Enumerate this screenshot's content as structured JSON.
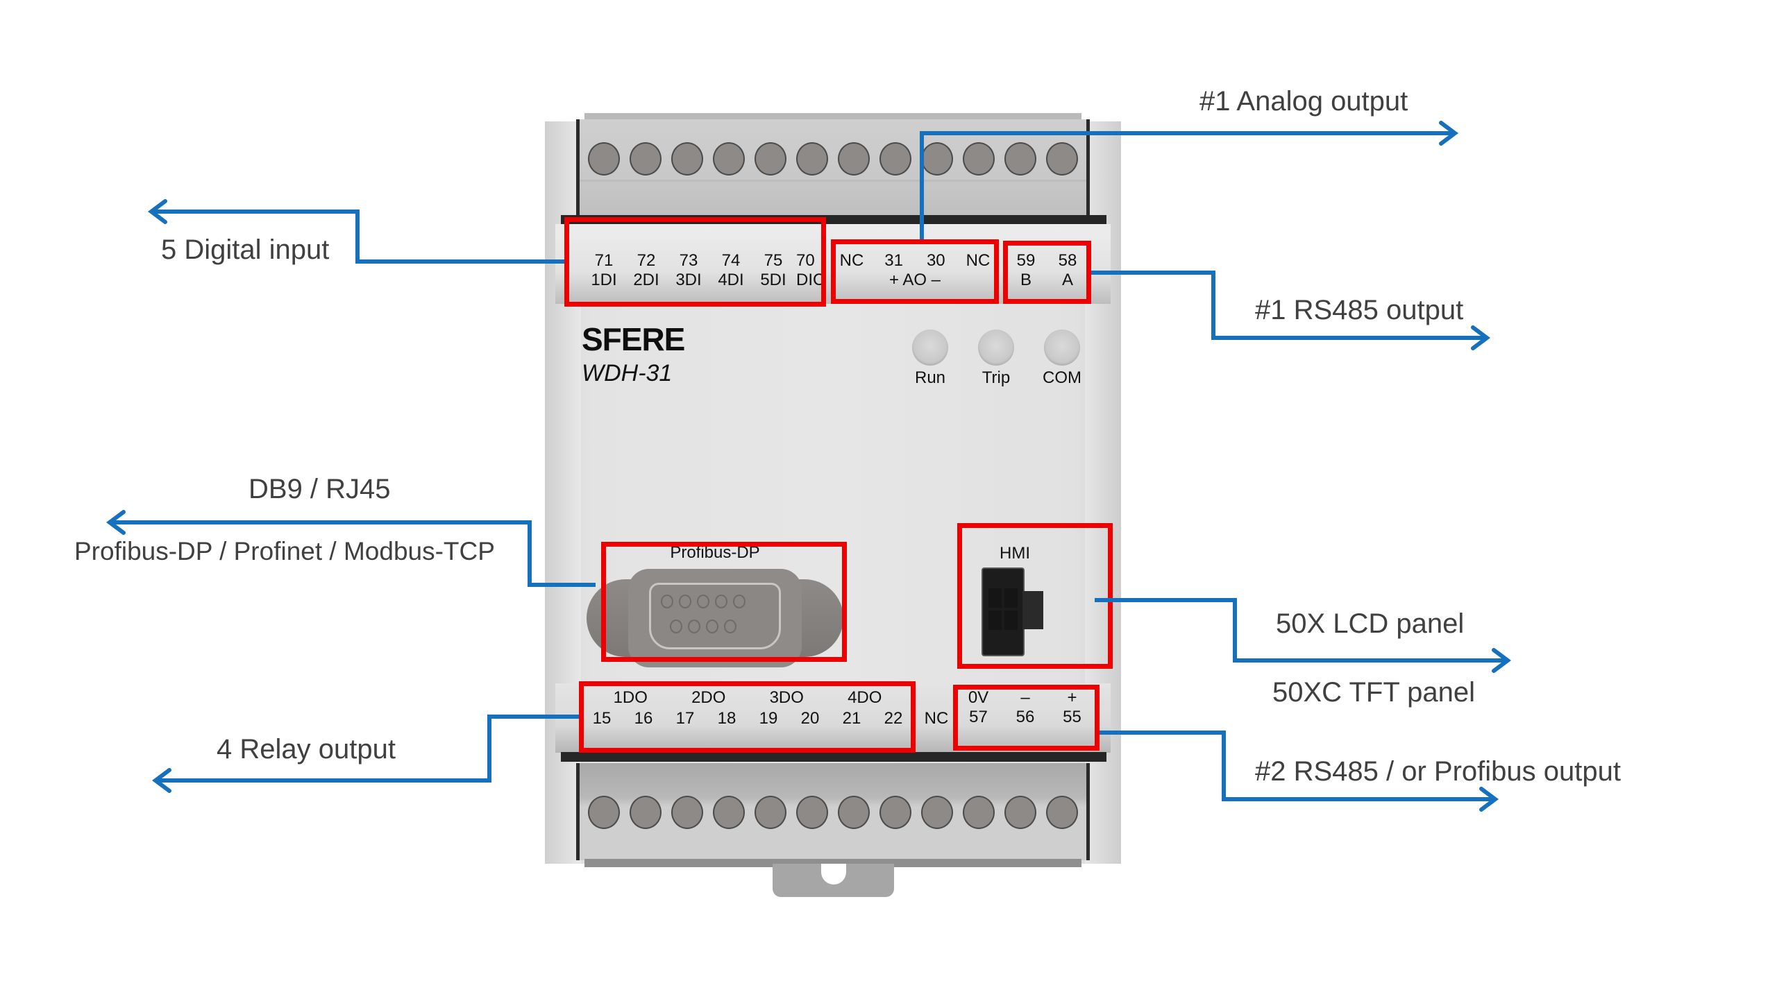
{
  "device": {
    "brand": "SFERE",
    "model": "WDH-31",
    "leds": [
      {
        "label": "Run"
      },
      {
        "label": "Trip"
      },
      {
        "label": "COM"
      }
    ],
    "top_terminals": {
      "digital_inputs": [
        {
          "number": "71",
          "function": "1DI"
        },
        {
          "number": "72",
          "function": "2DI"
        },
        {
          "number": "73",
          "function": "3DI"
        },
        {
          "number": "74",
          "function": "4DI"
        },
        {
          "number": "75",
          "function": "5DI"
        },
        {
          "number": "70",
          "function": "DIC"
        }
      ],
      "analog_output": {
        "numbers": [
          "NC",
          "31",
          "30",
          "NC"
        ],
        "function": "+ AO –"
      },
      "rs485_1": [
        {
          "number": "59",
          "function": "B"
        },
        {
          "number": "58",
          "function": "A"
        }
      ]
    },
    "bottom_terminals": {
      "relay_outputs": [
        {
          "label": "1DO",
          "numbers": [
            "15",
            "16"
          ]
        },
        {
          "label": "2DO",
          "numbers": [
            "17",
            "18"
          ]
        },
        {
          "label": "3DO",
          "numbers": [
            "19",
            "20"
          ]
        },
        {
          "label": "4DO",
          "numbers": [
            "21",
            "22"
          ]
        }
      ],
      "nc_label": "NC",
      "power": [
        {
          "function": "0V",
          "number": "57"
        },
        {
          "function": "–",
          "number": "56"
        },
        {
          "function": "+",
          "number": "55"
        }
      ]
    },
    "db9_label": "Profibus-DP",
    "hmi_label": "HMI"
  },
  "annotations": {
    "digital_input": "5 Digital input",
    "analog_output": "#1 Analog output",
    "rs485_1": "#1 RS485 output",
    "db9_title": "DB9 /  RJ45",
    "db9_protocols": "Profibus-DP /  Profinet / Modbus-TCP",
    "lcd_panel": "50X  LCD panel",
    "tft_panel": "50XC  TFT panel",
    "relay_output": "4 Relay output",
    "rs485_2": "#2 RS485 / or  Profibus  output"
  },
  "colors": {
    "callout_line": "#1570bd",
    "highlight_box": "#ee0000"
  }
}
